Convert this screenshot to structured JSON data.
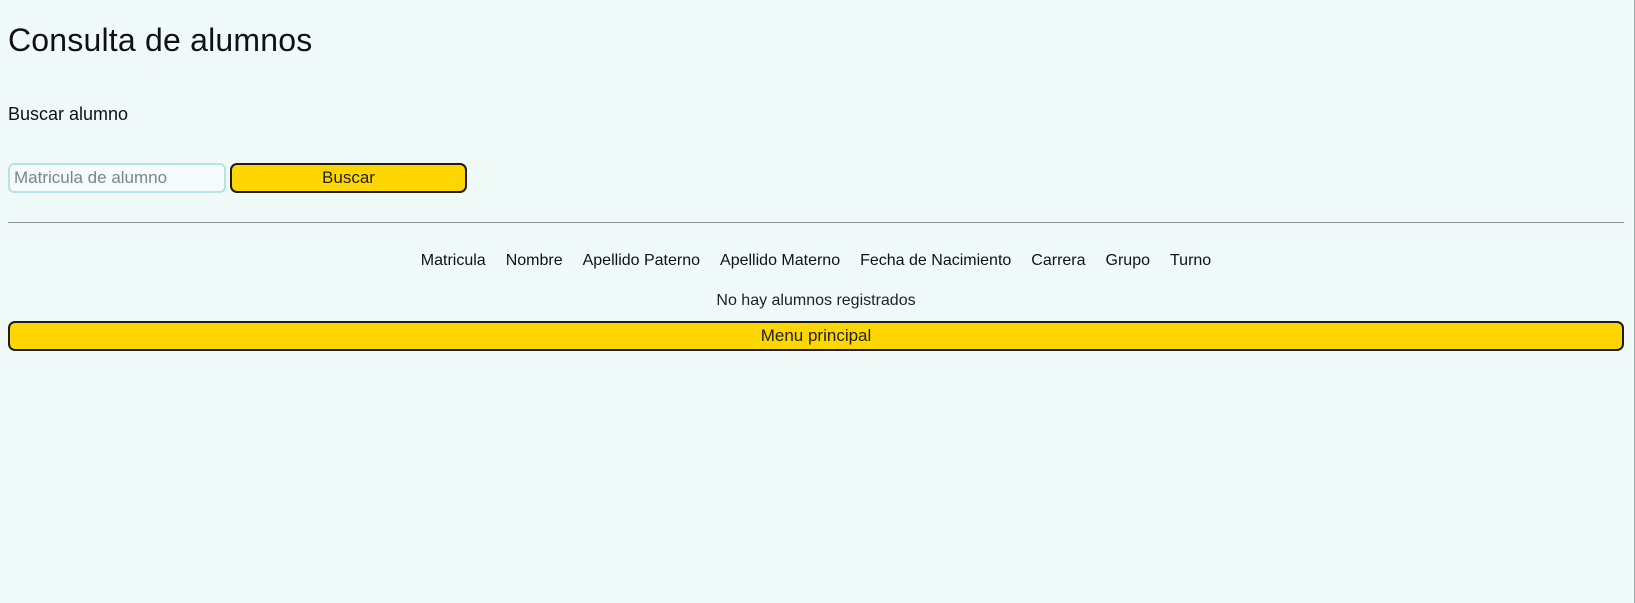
{
  "page": {
    "title": "Consulta de alumnos",
    "search_heading": "Buscar alumno"
  },
  "search": {
    "placeholder": "Matricula de alumno",
    "value": "",
    "button_label": "Buscar"
  },
  "table": {
    "columns": [
      "Matricula",
      "Nombre",
      "Apellido Paterno",
      "Apellido Materno",
      "Fecha de Nacimiento",
      "Carrera",
      "Grupo",
      "Turno"
    ],
    "rows": [],
    "empty_message": "No hay alumnos registrados"
  },
  "menu": {
    "main_button_label": "Menu principal"
  },
  "colors": {
    "background": "#f0fbf9",
    "button_accent": "#ffd600",
    "input_border": "#b5e3e8"
  }
}
